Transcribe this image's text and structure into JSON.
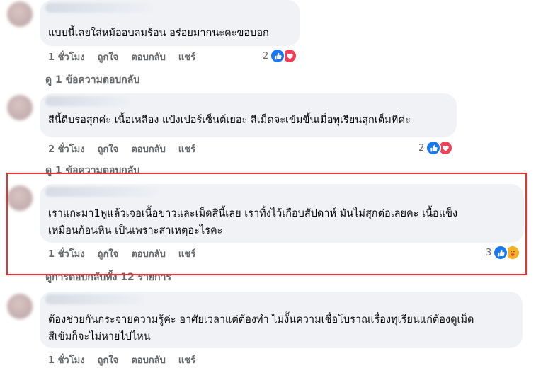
{
  "comments": [
    {
      "text_lines": [
        "แบบนี้เลยใส่หม้ออบลมร้อน อร่อยมากนะคะขอบอก"
      ],
      "time": "1 ชั่วโมง",
      "like_label": "ถูกใจ",
      "reply_label": "ตอบกลับ",
      "share_label": "แชร์",
      "reaction_count": "2",
      "reactions": [
        "like-icon",
        "love-icon"
      ],
      "replies_link": "ดู 1 ข้อความตอบกลับ"
    },
    {
      "text_lines": [
        "สีนี้ดิบรอสุกค่ะ เนื้อเหลือง แป้งเปอร์เซ็นต์เยอะ สีเม็ดจะเข้มขึ้นเมื่อทุเรียนสุกเต็มที่ค่ะ"
      ],
      "time": "2 ชั่วโมง",
      "like_label": "ถูกใจ",
      "reply_label": "ตอบกลับ",
      "share_label": "แชร์",
      "reaction_count": "2",
      "reactions": [
        "like-icon",
        "love-icon"
      ],
      "replies_link": "ดู 1 ข้อความตอบกลับ"
    },
    {
      "text_lines": [
        "เราแกะมา1พูแล้วเจอเนื้อขาวและเม็ดสีนี้เลย เราทิ้งไว้เกือบสัปดาห์ มันไม่สุกต่อเลยคะ เนื้อแข็ง",
        "เหมือนก้อนหิน เป็นเพราะสาเหตุอะไรคะ"
      ],
      "time": "1 ชั่วโมง",
      "like_label": "ถูกใจ",
      "reply_label": "ตอบกลับ",
      "share_label": "แชร์",
      "reaction_count": "3",
      "reactions": [
        "like-icon",
        "care-icon"
      ],
      "replies_link": "ดูการตอบกลับทั้ง 12 รายการ"
    },
    {
      "text_lines": [
        "ต้องช่วยกันกระจายความรู้ค่ะ อาศัยเวลาแต่ต้องทำ ไม่งั้นความเชื่อโบราณเรื่องทุเรียนแก่ต้องดูเม็ด",
        "สีเข้มก็จะไม่หายไปไหน"
      ],
      "time": "1 ชั่วโมง",
      "like_label": "ถูกใจ",
      "reply_label": "ตอบกลับ",
      "share_label": "แชร์"
    }
  ],
  "colors": {
    "bubble": "#f0f2f5",
    "meta_text": "#65676b",
    "like": "#1877f2",
    "love": "#f33e58",
    "care": "#f7b125",
    "highlight_border": "#e33535"
  }
}
